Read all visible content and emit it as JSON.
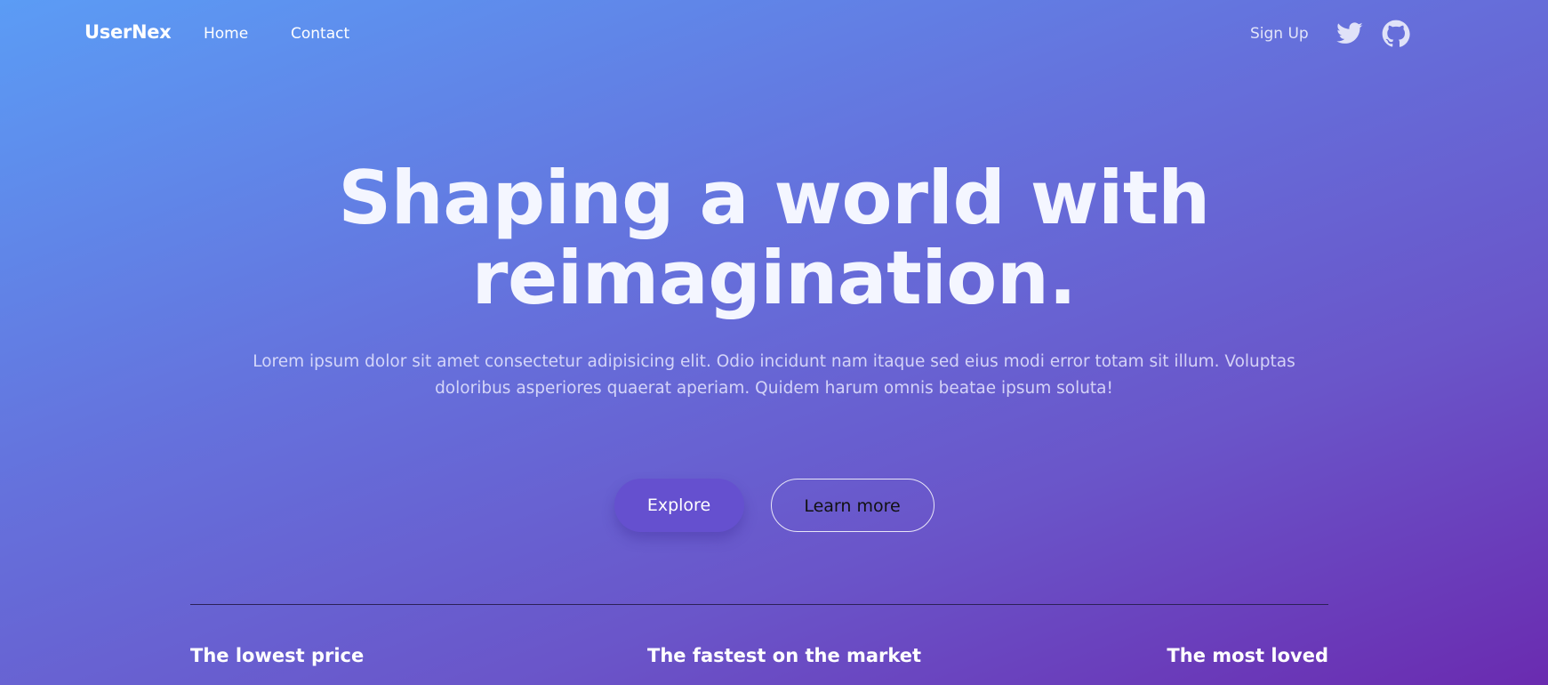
{
  "nav": {
    "brand": "UserNex",
    "links": [
      "Home",
      "Contact"
    ],
    "sign_up": "Sign Up",
    "icons": [
      "twitter-icon",
      "github-icon"
    ]
  },
  "hero": {
    "headline_line1": "Shaping a world with",
    "headline_line2": "reimagination.",
    "subtext": "Lorem ipsum dolor sit amet consectetur adipisicing elit. Odio incidunt nam itaque sed eius modi error totam sit illum. Voluptas doloribus asperiores quaerat aperiam. Quidem harum omnis beatae ipsum soluta!"
  },
  "actions": {
    "explore": "Explore",
    "learn_more": "Learn more"
  },
  "features": [
    "The lowest price",
    "The fastest on the market",
    "The most loved"
  ],
  "colors": {
    "gradient_start": "#5b9cf5",
    "gradient_end": "#6a2bb0",
    "explore_button": "#6550cf"
  }
}
